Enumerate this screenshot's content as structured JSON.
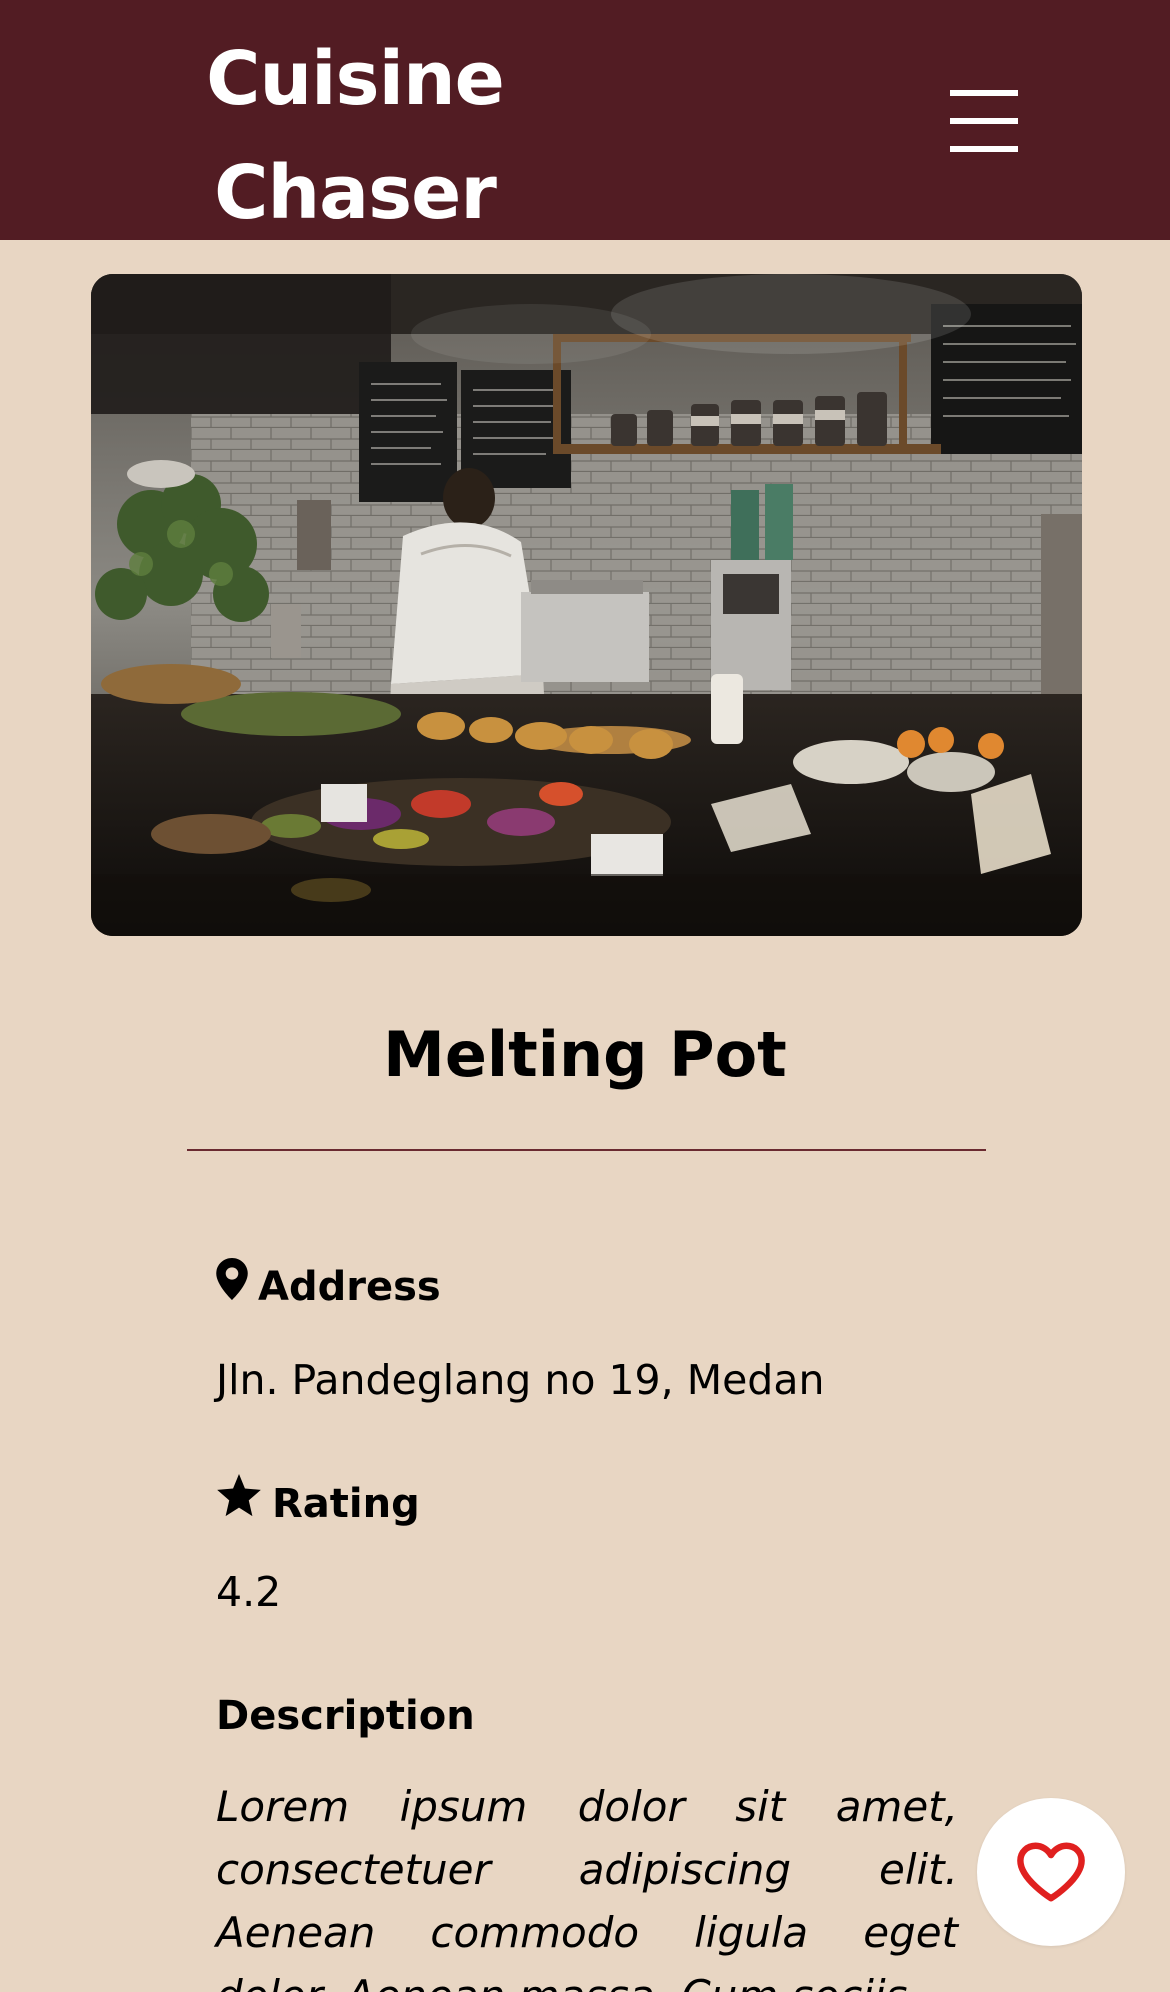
{
  "header": {
    "brand": "Cuisine Chaser",
    "menu_icon": "hamburger-menu-icon",
    "background_color": "#521c23"
  },
  "hero": {
    "image_description_icon": "restaurant-photo"
  },
  "restaurant": {
    "name": "Melting Pot",
    "address_label": "Address",
    "address_icon": "map-pin-icon",
    "address": "Jln. Pandeglang no 19, Medan",
    "rating_label": "Rating",
    "rating_icon": "star-icon",
    "rating": "4.2",
    "description_label": "Description",
    "description": "Lorem ipsum dolor sit amet, consectetuer adipiscing elit. Aenean commodo ligula eget dolor. Aenean massa. Cum sociis"
  },
  "favorite": {
    "icon": "heart-outline-icon",
    "accent_color": "#e0201f"
  },
  "colors": {
    "page_background": "#e8d6c3",
    "divider": "#6a2a30"
  }
}
